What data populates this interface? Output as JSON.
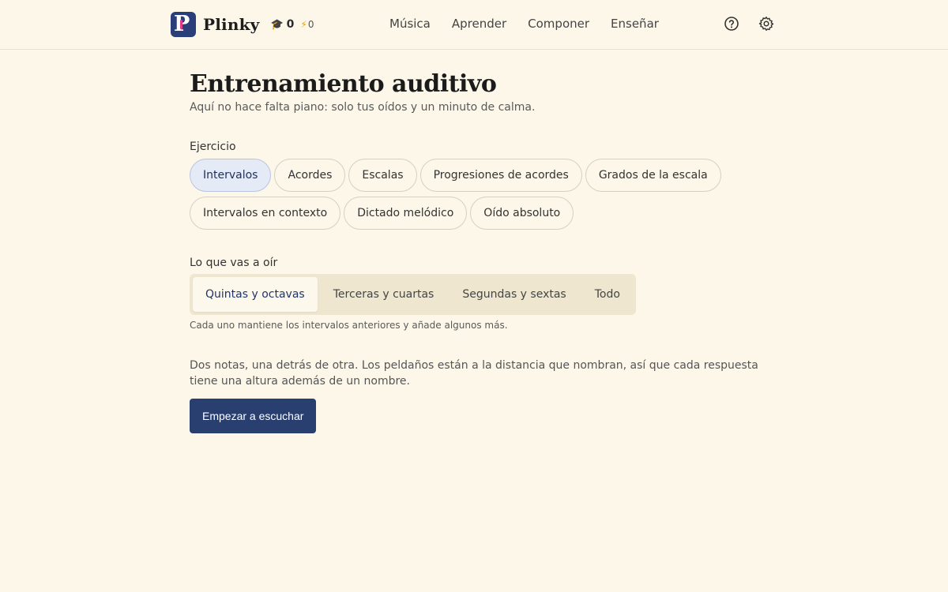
{
  "brand": {
    "name": "Plinky",
    "logo_letter": "P"
  },
  "stats": {
    "graduation": "0",
    "lightning": "0"
  },
  "nav": {
    "items": [
      "Música",
      "Aprender",
      "Componer",
      "Enseñar"
    ]
  },
  "page": {
    "title": "Entrenamiento auditivo",
    "subtitle": "Aquí no hace falta piano: solo tus oídos y un minuto de calma."
  },
  "exercise": {
    "label": "Ejercicio",
    "options": [
      "Intervalos",
      "Acordes",
      "Escalas",
      "Progresiones de acordes",
      "Grados de la escala",
      "Intervalos en contexto",
      "Dictado melódico",
      "Oído absoluto"
    ],
    "selected": "Intervalos"
  },
  "listen": {
    "label": "Lo que vas a oír",
    "options": [
      "Quintas y octavas",
      "Terceras y cuartas",
      "Segundas y sextas",
      "Todo"
    ],
    "selected": "Quintas y octavas",
    "hint": "Cada uno mantiene los intervalos anteriores y añade algunos más."
  },
  "description": "Dos notas, una detrás de otra. Los peldaños están a la distancia que nombran, así que cada respuesta tiene una altura además de un nombre.",
  "cta": {
    "label": "Empezar a escuchar"
  },
  "colors": {
    "background": "#fcf7e9",
    "accent": "#283f70",
    "chip_active": "#e4eaf6",
    "logo_bar": "#e23a8b"
  }
}
